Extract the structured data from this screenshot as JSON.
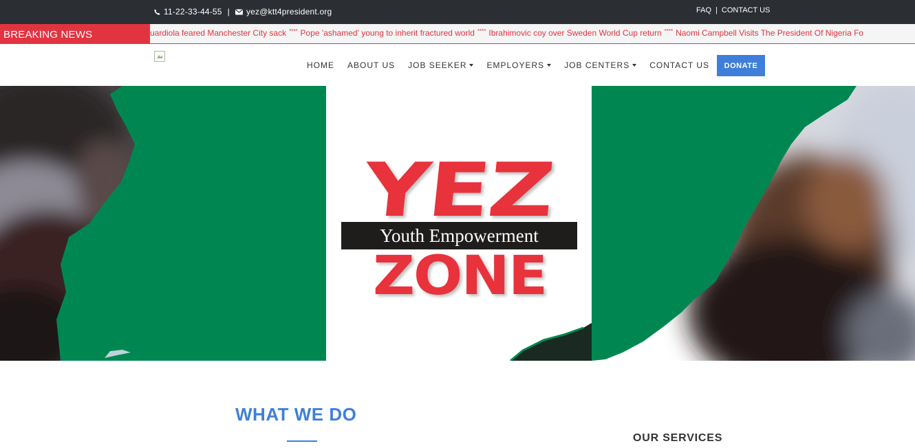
{
  "topbar": {
    "phone": "11-22-33-44-55",
    "email": "yez@ktt4president.org",
    "faq": "FAQ",
    "divider": "|",
    "contact": "CONTACT US"
  },
  "breaking_news": {
    "label": "BREAKING NEWS",
    "items": [
      "uardiola feared Manchester City sack",
      "Pope 'ashamed' young to inherit fractured world",
      "Ibrahimovic coy over Sweden World Cup return",
      "Naomi Campbell Visits The President Of Nigeria Fo"
    ],
    "separator": "****"
  },
  "nav": {
    "items": [
      {
        "label": "HOME",
        "caret": false
      },
      {
        "label": "ABOUT US",
        "caret": false
      },
      {
        "label": "JOB SEEKER",
        "caret": true
      },
      {
        "label": "EMPLOYERS",
        "caret": true
      },
      {
        "label": "JOB CENTERS",
        "caret": true
      },
      {
        "label": "CONTACT US",
        "caret": false
      }
    ],
    "donate": "DONATE"
  },
  "hero": {
    "logo_top": "YEZ",
    "logo_tagline": "Youth Empowerment",
    "logo_bottom": "ZONE",
    "colors": {
      "green": "#008751",
      "white": "#ffffff",
      "red": "#e8323c",
      "dark": "#1f1c1c"
    }
  },
  "content": {
    "section_title": "WHAT WE DO",
    "services_title": "OUR SERVICES"
  },
  "colors": {
    "topbar": "#2b2f33",
    "accent_red": "#e23440",
    "accent_blue": "#3f7fd9"
  },
  "icons": [
    "phone-icon",
    "envelope-icon",
    "broken-image-icon",
    "caret-down-icon"
  ]
}
